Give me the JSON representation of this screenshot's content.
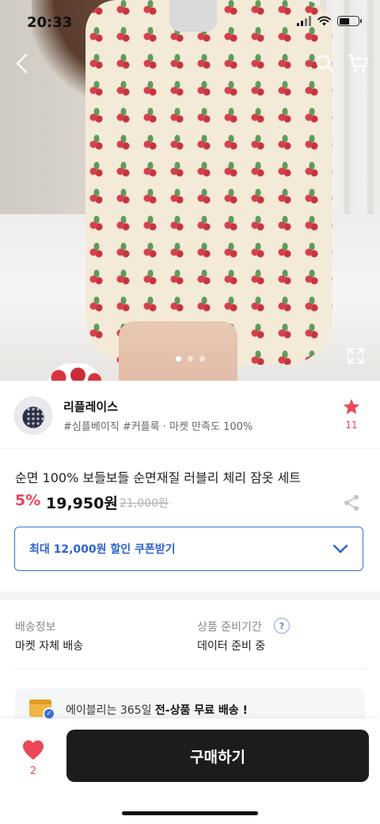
{
  "status": {
    "time": "20:33"
  },
  "gallery": {
    "slide_index": 1,
    "slide_count": 3
  },
  "icons": {
    "back": "chevron-left-icon",
    "search": "search-icon",
    "cart": "cart-icon",
    "expand": "expand-icon",
    "star": "star-icon",
    "share": "share-icon",
    "coupon_toggle": "chevron-down-icon",
    "help": "question-icon",
    "like": "heart-icon"
  },
  "shop": {
    "name": "리플레이스",
    "tags": "#심플베이직 #커플룩 · 마켓 만족도 100%",
    "favorite_count": "11"
  },
  "product": {
    "title": "순면 100% 보들보들 순면재질 러블리 체리 잠옷 세트",
    "discount": "5%",
    "price": "19,950원",
    "original_price": "21,000원"
  },
  "coupon": {
    "label": "최대 12,000원 할인 쿠폰받기"
  },
  "shipping": {
    "label": "배송정보",
    "value": "마켓 자체 배송"
  },
  "prep": {
    "label": "상품 준비기간",
    "help": "?",
    "value": "데이터 준비 중"
  },
  "banner": {
    "prefix": "에이블리는 365일 ",
    "highlight": "전-상품 무료 배송 !"
  },
  "bottom": {
    "like_count": "2",
    "buy_label": "구매하기"
  },
  "colors": {
    "accent_blue": "#2d62cf",
    "sale_red": "#f0415a",
    "heart_red": "#ec4757",
    "buy_button": "#1c1c1c"
  }
}
